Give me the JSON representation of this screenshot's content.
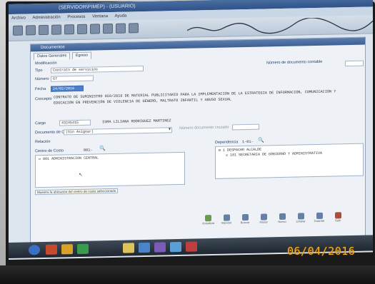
{
  "window": {
    "title": "(SERVIDOR\\PIMEP) - (USUARIO)",
    "menu": [
      "Archivo",
      "Administración",
      "Procesos",
      "Ventana",
      "Ayuda"
    ]
  },
  "document": {
    "panel_title": "Documentos",
    "tabs": [
      "Datos Generales",
      "Egreso"
    ],
    "section": "Modificación",
    "labels": {
      "tipo": "Tipo",
      "numero": "Número",
      "fecha": "Fecha",
      "concepto": "Concepto",
      "cargo": "Cargo",
      "doc_cruce": "Documento de Cruce",
      "relacion": "Relación",
      "centro_costo": "Centro de Costo",
      "dependencia": "Dependencia",
      "numero_doc_cruce": "Número documento cruzado",
      "numero_doc_contable": "Número de documento contable"
    },
    "values": {
      "tipo": "Contrato de servicios",
      "numero": "67",
      "fecha": "24/02/2016",
      "concepto_line1": "CONTRATO DE SUMINISTRO 059/2016 DE MATERIAL PUBLICITARIO PARA LA IMPLEMENTACIÓN DE LA ESTRATEGIA DE INFORMACIÓN, COMUNICACIÓN Y",
      "concepto_line2": "EDUCACIÓN EN PREVENCIÓN DE VIOLENCIA DE GÉNERO, MALTRATO INFANTIL Y ABUSO SEXUAL",
      "cargo_id": "43245415",
      "cargo_name": "ISMA LILIANA RODRIGUEZ MARTINEZ",
      "doc_cruce": "(Sin Asignar)",
      "centro_costo_code": "001-",
      "dependencia_code": "1-01-"
    },
    "centro_costo_tree": [
      "001 ADMINISTRACION CENTRAL"
    ],
    "dependencia_tree": [
      "1 DESPACHO ALCALDE",
      "101 SECRETARIA DE GOBIERNO Y ADMINISTRATIVA"
    ],
    "hint": "Muestra la ubicación del centro de costo seleccionado",
    "toolbar_buttons": [
      "Actualizar",
      "Imprimir",
      "Buscar",
      "Anular",
      "Nuevo",
      "Limpiar",
      "Guardar",
      "Salir"
    ]
  },
  "photo_stamp": "06/04/2016"
}
